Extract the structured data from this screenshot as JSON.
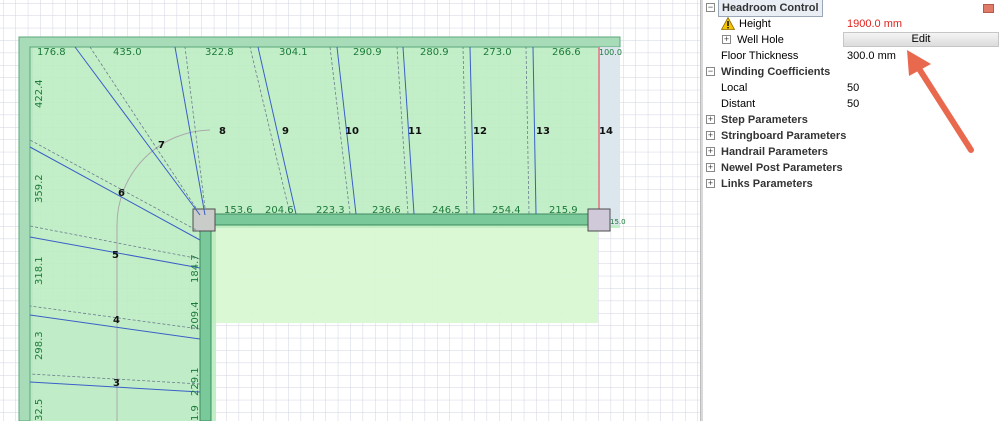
{
  "drawing": {
    "top_dims": [
      "176.8",
      "435.0",
      "322.8",
      "304.1",
      "290.9",
      "280.9",
      "273.0",
      "266.6",
      "100.0"
    ],
    "inner_dims": [
      "153.6",
      "204.6",
      "223.3",
      "236.6",
      "246.5",
      "254.4",
      "215.9"
    ],
    "left_dims": [
      "422.4",
      "359.2",
      "318.1",
      "298.3",
      "32.5"
    ],
    "inner_left_dims": [
      "184.7",
      "209.4",
      "229.1",
      "1.9"
    ],
    "step_numbers": [
      "3",
      "4",
      "5",
      "6",
      "7",
      "8",
      "9",
      "10",
      "11",
      "12",
      "13",
      "14"
    ],
    "small_label": "15.0"
  },
  "panel": {
    "headroom_header": "Headroom Control",
    "height_label": "Height",
    "height_value": "1900.0 mm",
    "well_hole_label": "Well Hole",
    "edit_label": "Edit",
    "floor_thickness_label": "Floor Thickness",
    "floor_thickness_value": "300.0 mm",
    "winding_header": "Winding Coefficients",
    "local_label": "Local",
    "local_value": "50",
    "distant_label": "Distant",
    "distant_value": "50",
    "sections": [
      "Step Parameters",
      "Stringboard Parameters",
      "Handrail Parameters",
      "Newel Post Parameters",
      "Links Parameters"
    ],
    "minus": "−",
    "plus": "+"
  },
  "colors": {
    "accent_arrow": "#e9694f",
    "warning_red": "#e0231e",
    "stair_fill": "#b3ecb6",
    "stair_border": "#8fd2a3"
  }
}
